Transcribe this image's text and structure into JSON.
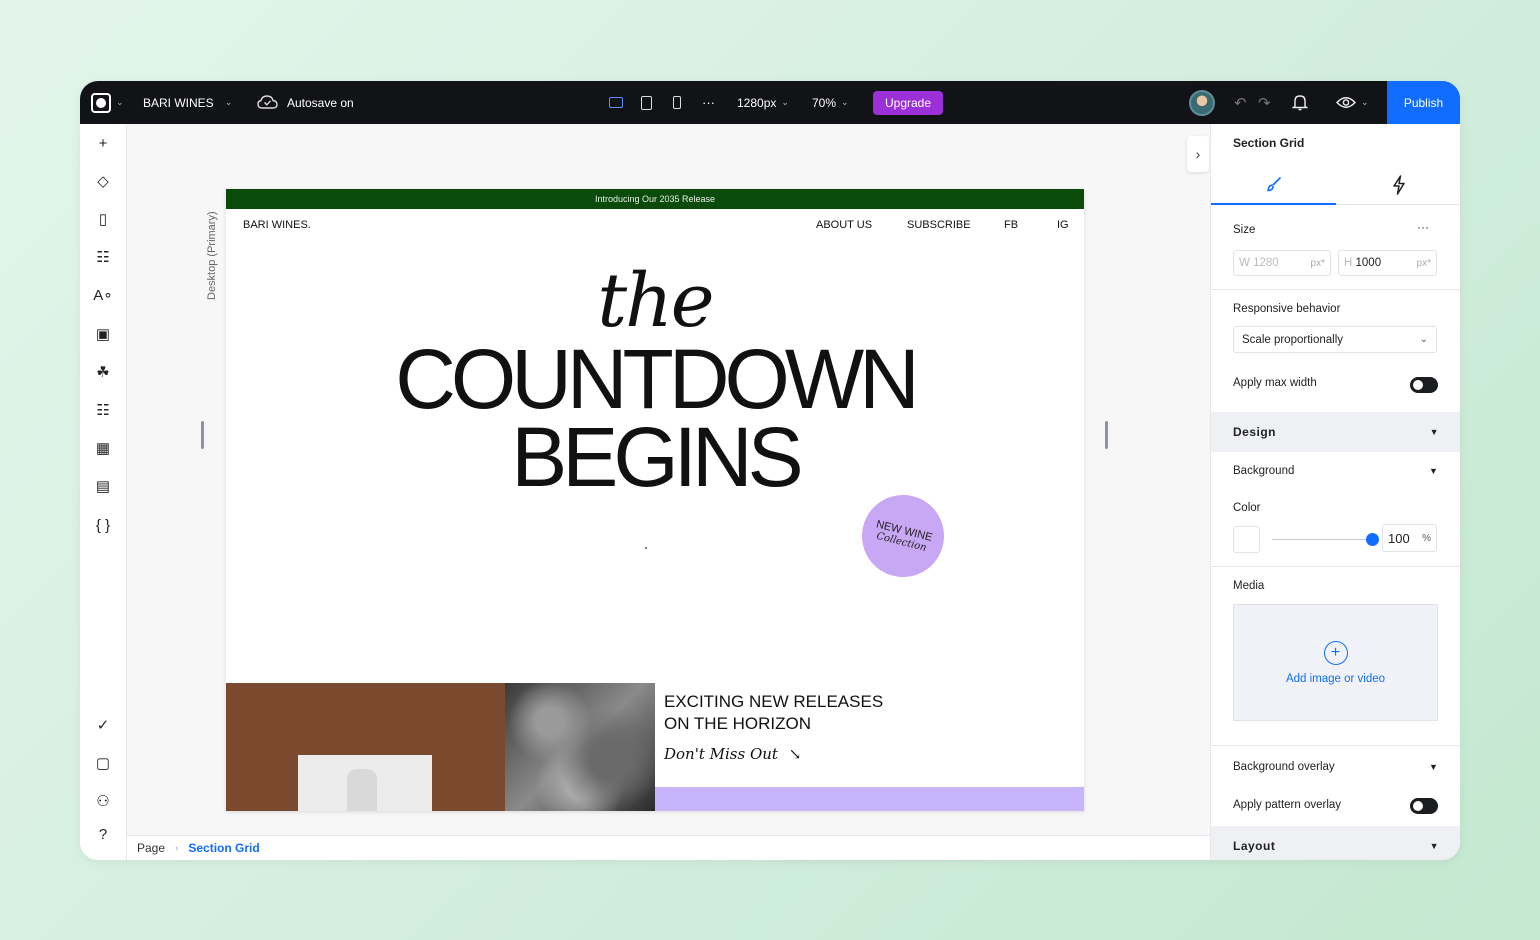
{
  "app": {
    "site_name": "BARI WINES",
    "autosave": "Autosave on",
    "breakpoint": "1280px",
    "zoom": "70%",
    "upgrade_label": "Upgrade",
    "publish_label": "Publish",
    "more": "···"
  },
  "icons": {
    "logo": "wix-logo-icon",
    "cloud": "cloud-check-icon",
    "desktop": "desktop-icon",
    "tablet": "tablet-icon",
    "mobile": "mobile-icon",
    "undo": "undo-icon",
    "redo": "redo-icon",
    "bell": "bell-icon",
    "eye": "eye-icon"
  },
  "left_toolbar": [
    {
      "name": "add-icon",
      "glyph": "+"
    },
    {
      "name": "layers-icon",
      "glyph": "◇"
    },
    {
      "name": "pages-icon",
      "glyph": "▯"
    },
    {
      "name": "sitemap-icon",
      "glyph": "☷"
    },
    {
      "name": "text-theme-icon",
      "glyph": "A∘"
    },
    {
      "name": "media-icon",
      "glyph": "▣"
    },
    {
      "name": "components-icon",
      "glyph": "☘"
    },
    {
      "name": "apps-icon",
      "glyph": "☷"
    },
    {
      "name": "app-market-icon",
      "glyph": "▦"
    },
    {
      "name": "table-icon",
      "glyph": "▤"
    },
    {
      "name": "code-icon",
      "glyph": "{ }"
    }
  ],
  "left_toolbar_bottom": [
    {
      "name": "checklist-icon",
      "glyph": "✓"
    },
    {
      "name": "comments-icon",
      "glyph": "▢"
    },
    {
      "name": "community-icon",
      "glyph": "⚇"
    },
    {
      "name": "help-icon",
      "glyph": "?"
    }
  ],
  "canvas": {
    "breakpoint_label": "Desktop (Primary)"
  },
  "site": {
    "banner": "Introducing Our 2035 Release",
    "brand": "BARI WINES.",
    "nav": [
      "ABOUT US",
      "SUBSCRIBE",
      "FB",
      "IG"
    ],
    "hero_the": "the",
    "hero_line1": "COUNTDOWN",
    "hero_line2": "BEGINS",
    "badge_line1": "NEW WINE",
    "badge_line2": "Collection",
    "releases_line1": "EXCITING NEW RELEASES",
    "releases_line2": "ON THE HORIZON",
    "cta": "Don't Miss Out",
    "cta_arrow": "↘"
  },
  "breadcrumb": {
    "root": "Page",
    "separator": "›",
    "current": "Section Grid"
  },
  "panel": {
    "title": "Section Grid",
    "tabs": [
      {
        "name": "design-tab",
        "icon": "brush-icon",
        "glyph": "🖌",
        "selected": true
      },
      {
        "name": "interactions-tab",
        "icon": "lightning-icon",
        "glyph": "ϟ",
        "selected": false
      }
    ],
    "size_label": "Size",
    "size_more": "···",
    "width_prefix": "W",
    "width_value": "1280",
    "height_prefix": "H",
    "height_value": "1000",
    "unit": "px*",
    "responsive_label": "Responsive behavior",
    "responsive_value": "Scale proportionally",
    "max_width_label": "Apply max width",
    "max_width_on": false,
    "design_label": "Design",
    "background_label": "Background",
    "color_label": "Color",
    "opacity_value": "100",
    "opacity_unit": "%",
    "media_label": "Media",
    "add_media_label": "Add image or video",
    "overlay_label": "Background overlay",
    "pattern_label": "Apply pattern overlay",
    "pattern_on": false,
    "layout_label": "Layout"
  },
  "colors": {
    "topbar": "#121316",
    "accent": "#116dff",
    "upgrade": "#9b2fd8",
    "banner": "#0a4a0a",
    "badge": "#c8a7f5",
    "brown": "#7b4a2e",
    "lavender": "#c8b4fa"
  }
}
